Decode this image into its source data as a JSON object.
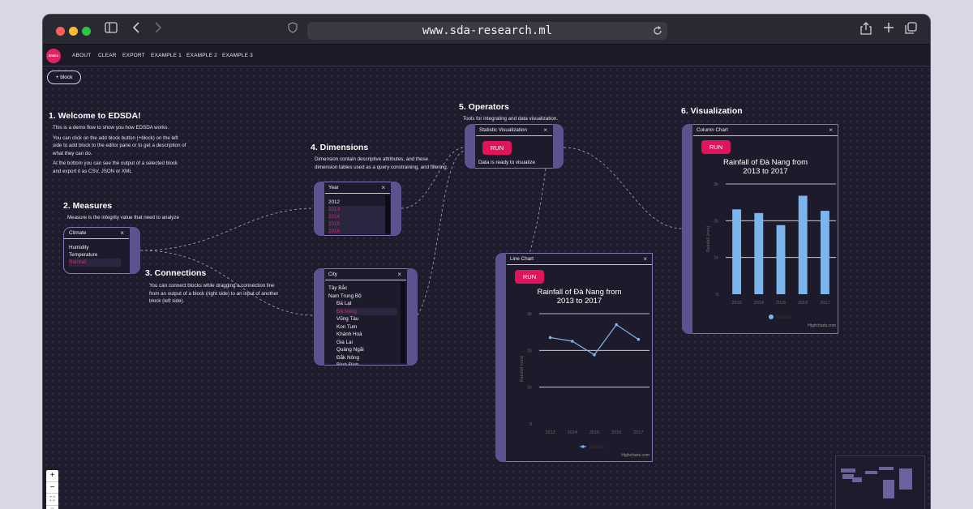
{
  "browser": {
    "url": "www.sda-research.ml"
  },
  "menu": {
    "logo": "EDSDA",
    "items": [
      "ABOUT",
      "CLEAR",
      "EXPORT",
      "EXAMPLE 1",
      "EXAMPLE 2",
      "EXAMPLE 3"
    ]
  },
  "add_block_label": "+ block",
  "welcome": {
    "title": "1. Welcome to EDSDA!",
    "p1": "This is a demo flow to show you how EDSDA works.",
    "p2a": "You can click on the add block button (+block) on the left",
    "p2b": "side to add block to the editor pane or to get a description of",
    "p2c": "what they can do.",
    "p3a": "At the bottom you can see the output of a selected block",
    "p3b": "and export it as CSV, JSON or XML"
  },
  "measures": {
    "title": "2. Measures",
    "desc": "Measure is the integrity value that need to analyze",
    "panel_title": "Climate",
    "items": [
      "Humidity",
      "Temperature",
      "Rainfall"
    ]
  },
  "connections": {
    "title": "3. Connections",
    "l1": "You can connect blocks while dragging a connection line",
    "l2": "from an output of a block (right side) to an input of another",
    "l3": "block (left side)."
  },
  "dimensions": {
    "title": "4. Dimensions",
    "l1": "Dimension contain descriptive attributes, and these",
    "l2": "dimension tables used as a query constraining, and filtering.",
    "year_title": "Year",
    "years": [
      "2012",
      "2013",
      "2014",
      "2015",
      "2016"
    ],
    "city_title": "City",
    "cities": [
      "Tây Bắc",
      "Nam Trung Bộ",
      "Đà Lạt",
      "Đà Nang",
      "Vũng Tàu",
      "Kon Tum",
      "Khánh Hoà",
      "Gia Lai",
      "Quảng Ngãi",
      "Đắk Nông",
      "Bình Định"
    ]
  },
  "operators": {
    "title": "5. Operators",
    "desc": "Tools for integrating and data visualization.",
    "panel_title": "Statistic Visualization",
    "run": "RUN",
    "status": "Data is ready to visualize"
  },
  "visualization": {
    "title": "6. Visualization"
  },
  "close_glyph": "×",
  "chart_data": [
    {
      "type": "line",
      "panel_title": "Line Chart",
      "run": "RUN",
      "title": "Rainfall of Đà Nang from 2013 to 2017",
      "title_l1": "Rainfall of Đà Nang from",
      "title_l2": "2013 to 2017",
      "ylabel": "Rainfall (mm)",
      "categories": [
        "2013",
        "2014",
        "2015",
        "2016",
        "2017"
      ],
      "series": [
        {
          "name": "Rainfall",
          "values": [
            2350,
            2250,
            1880,
            2700,
            2300
          ]
        }
      ],
      "ylim": [
        0,
        3000
      ],
      "yticks": [
        "0",
        "1k",
        "2k",
        "3k"
      ],
      "legend": "bottom",
      "credit": "Highcharts.com",
      "color": "#7cb5ec"
    },
    {
      "type": "bar",
      "panel_title": "Column Chart",
      "run": "RUN",
      "title": "Rainfall of Đà Nang from 2013 to 2017",
      "title_l1": "Rainfall of Đà Nang from",
      "title_l2": "2013 to 2017",
      "ylabel": "Rainfall (mm)",
      "categories": [
        "2013",
        "2014",
        "2015",
        "2016",
        "2017"
      ],
      "series": [
        {
          "name": "Rainfall",
          "values": [
            2310,
            2210,
            1880,
            2680,
            2270
          ]
        }
      ],
      "ylim": [
        0,
        3000
      ],
      "yticks": [
        "0",
        "1k",
        "2k",
        "3k"
      ],
      "legend": "bottom",
      "credit": "Highcharts.com",
      "color": "#7cb5ec"
    }
  ],
  "zoom": [
    "+",
    "−",
    "⛶",
    "🔒"
  ]
}
